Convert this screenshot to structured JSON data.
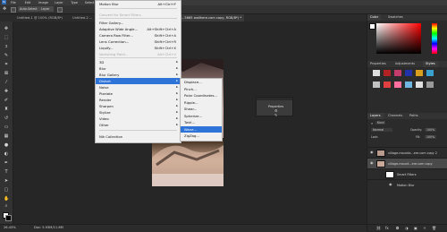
{
  "menubar": {
    "items": [
      "File",
      "Edit",
      "Image",
      "Layer",
      "Type",
      "Select",
      "Filter",
      "3D",
      "View",
      "Window",
      "Help"
    ]
  },
  "options": {
    "auto_select": "Auto-Select",
    "layer": "Layer"
  },
  "tabs": [
    {
      "label": "Untitled-1 @ 100% (RGB/8*)"
    },
    {
      "label": "Untitled-2 ..."
    },
    {
      "label": "...5665 wallhere.com copy, RGB/8*) *"
    }
  ],
  "filter_menu": {
    "items": [
      {
        "label": "Motion Blur",
        "shortcut": "Alt+Ctrl+F",
        "disabled": false
      },
      {
        "label": "Convert for Smart Filters",
        "shortcut": "",
        "disabled": true
      },
      {
        "label": "Filter Gallery...",
        "shortcut": "",
        "disabled": false
      },
      {
        "label": "Adaptive Wide Angle...",
        "shortcut": "Alt+Shift+Ctrl+A",
        "disabled": false
      },
      {
        "label": "Camera Raw Filter...",
        "shortcut": "Shift+Ctrl+A",
        "disabled": false
      },
      {
        "label": "Lens Correction...",
        "shortcut": "Shift+Ctrl+R",
        "disabled": false
      },
      {
        "label": "Liquify...",
        "shortcut": "Shift+Ctrl+X",
        "disabled": false
      },
      {
        "label": "Vanishing Point...",
        "shortcut": "Alt+Ctrl+V",
        "disabled": true
      },
      {
        "label": "3D",
        "submenu": true
      },
      {
        "label": "Blur",
        "submenu": true
      },
      {
        "label": "Blur Gallery",
        "submenu": true
      },
      {
        "label": "Distort",
        "submenu": true,
        "selected": true
      },
      {
        "label": "Noise",
        "submenu": true
      },
      {
        "label": "Pixelate",
        "submenu": true
      },
      {
        "label": "Render",
        "submenu": true
      },
      {
        "label": "Sharpen",
        "submenu": true
      },
      {
        "label": "Stylize",
        "submenu": true
      },
      {
        "label": "Video",
        "submenu": true
      },
      {
        "label": "Other",
        "submenu": true
      },
      {
        "label": "Nik Collection",
        "submenu": false
      }
    ]
  },
  "distort_menu": {
    "items": [
      {
        "label": "Displace..."
      },
      {
        "label": "Pinch..."
      },
      {
        "label": "Polar Coordinates..."
      },
      {
        "label": "Ripple..."
      },
      {
        "label": "Shear..."
      },
      {
        "label": "Spherize..."
      },
      {
        "label": "Twirl..."
      },
      {
        "label": "Wave...",
        "selected": true
      },
      {
        "label": "ZigZag..."
      }
    ]
  },
  "properties_panel": {
    "title": "Properties"
  },
  "status": {
    "zoom": "26.43%",
    "doc": "Doc: 5.93M/11.6M"
  },
  "right": {
    "color_tabs": [
      "Color",
      "Swatches"
    ],
    "prop_tabs": [
      "Properties",
      "Adjustments",
      "Styles"
    ],
    "layers_tabs": [
      "Layers",
      "Channels",
      "Paths"
    ],
    "kind_label": "Kind",
    "blend_mode": "Normal",
    "opacity_label": "Opacity:",
    "opacity_value": "100%",
    "lock_label": "Lock:",
    "fill_label": "Fill:",
    "fill_value": "100%",
    "layers": [
      {
        "name": "village-mounta...ere.com copy 2"
      },
      {
        "name": "village-mount...ere.com copy"
      },
      {
        "name": "Smart Filters"
      },
      {
        "name": "Motion Blur"
      }
    ]
  },
  "colors": {
    "accent": "#2e73d8"
  }
}
